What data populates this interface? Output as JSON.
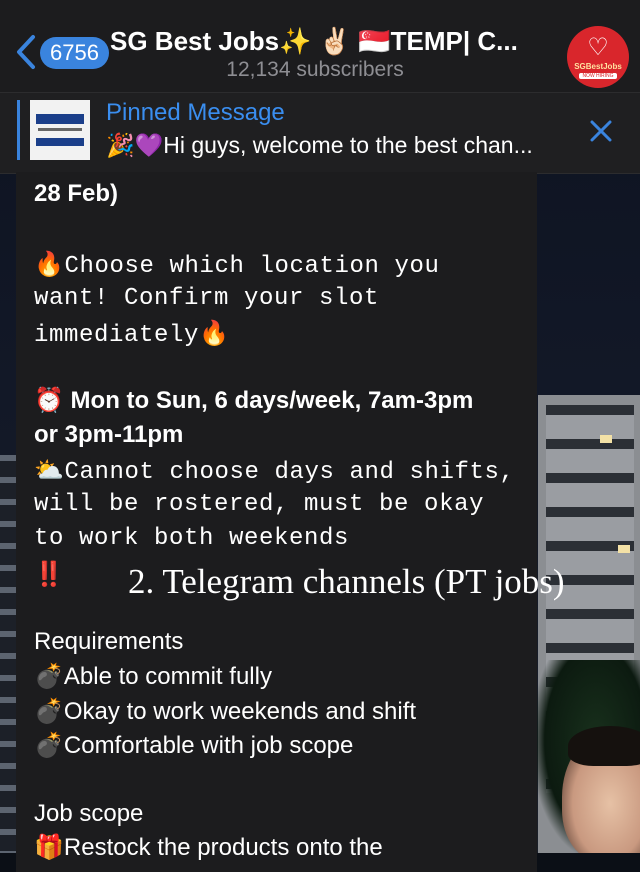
{
  "header": {
    "unread_count": "6756",
    "title": "SG Best Jobs✨ ✌🏻 🇸🇬TEMP| C...",
    "subtitle": "12,134 subscribers"
  },
  "pinned": {
    "title": "Pinned Message",
    "text": "🎉💜Hi guys, welcome to the best chan..."
  },
  "message": {
    "lines": [
      {
        "text": "28 Feb)",
        "style": "sans bold"
      },
      {
        "text": "🔥Choose which location you",
        "style": "mono"
      },
      {
        "text": "want! Confirm your slot",
        "style": "mono"
      },
      {
        "text": "immediately🔥",
        "style": "mono"
      },
      {
        "text": "⏰ Mon to Sun, 6 days/week, 7am-3pm",
        "style": "sans bold"
      },
      {
        "text": "or 3pm-11pm",
        "style": "sans bold"
      },
      {
        "text": "⛅Cannot choose days and shifts,",
        "style": "mono"
      },
      {
        "text": "will be rostered, must be okay",
        "style": "mono"
      },
      {
        "text": "to work both weekends",
        "style": "mono"
      },
      {
        "text": "‼️",
        "style": "sans"
      },
      {
        "text": "Requirements",
        "style": "sans"
      },
      {
        "text": "💣Able to commit fully",
        "style": "sans"
      },
      {
        "text": "💣Okay to work weekends and shift",
        "style": "sans"
      },
      {
        "text": "💣Comfortable with job scope",
        "style": "sans"
      },
      {
        "text": "Job scope",
        "style": "sans"
      },
      {
        "text": "🎁Restock the products onto the",
        "style": "sans"
      }
    ]
  },
  "overlay_caption": "2. Telegram channels (PT jobs)",
  "colors": {
    "accent": "#3a84de",
    "header_bg": "#1c1c1e",
    "bubble_bg": "#1c1c1e",
    "avatar_bg": "#d9262c"
  },
  "icons": [
    "back-chevron-icon",
    "close-icon",
    "channel-avatar-icon",
    "pinned-thumbnail-icon"
  ]
}
